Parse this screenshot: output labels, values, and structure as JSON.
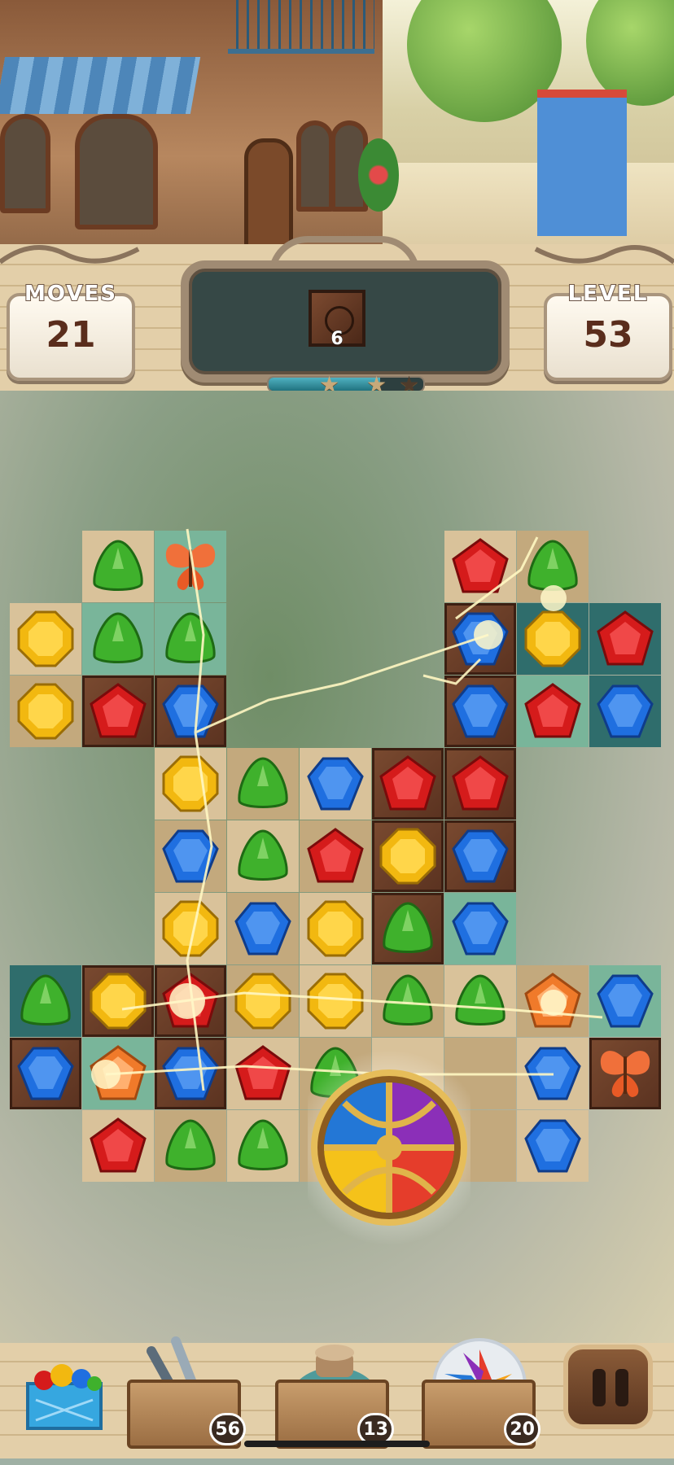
{
  "hud": {
    "moves_label": "MOVES",
    "moves_value": "21",
    "level_label": "LEVEL",
    "level_value": "53",
    "goal_count": "6",
    "goal_icon": "wood-crate-tile",
    "progress_fraction": 0.72,
    "stars_total": 3,
    "stars_earned": 2
  },
  "board": {
    "gem_colors": {
      "green": "#3fb12c",
      "yellow": "#f2b810",
      "blue": "#1f6fe0",
      "red": "#d51b1b",
      "orange": "#f07a2a"
    },
    "cells": [
      {
        "r": 0,
        "c": 1,
        "bg": "light",
        "gem": "green"
      },
      {
        "r": 0,
        "c": 2,
        "bg": "tealLight",
        "gem": "butterfly"
      },
      {
        "r": 0,
        "c": 6,
        "bg": "light",
        "gem": "red"
      },
      {
        "r": 0,
        "c": 7,
        "bg": "dark",
        "gem": "green"
      },
      {
        "r": 1,
        "c": 0,
        "bg": "light",
        "gem": "yellow"
      },
      {
        "r": 1,
        "c": 1,
        "bg": "tealLight",
        "gem": "green"
      },
      {
        "r": 1,
        "c": 2,
        "bg": "tealLight",
        "gem": "green"
      },
      {
        "r": 1,
        "c": 6,
        "bg": "wood",
        "gem": "blue"
      },
      {
        "r": 1,
        "c": 7,
        "bg": "teal",
        "gem": "yellow"
      },
      {
        "r": 1,
        "c": 8,
        "bg": "teal",
        "gem": "red"
      },
      {
        "r": 2,
        "c": 0,
        "bg": "dark",
        "gem": "yellow"
      },
      {
        "r": 2,
        "c": 1,
        "bg": "wood",
        "gem": "red"
      },
      {
        "r": 2,
        "c": 2,
        "bg": "wood",
        "gem": "blue"
      },
      {
        "r": 2,
        "c": 6,
        "bg": "wood",
        "gem": "blue"
      },
      {
        "r": 2,
        "c": 7,
        "bg": "tealLight",
        "gem": "red"
      },
      {
        "r": 2,
        "c": 8,
        "bg": "teal",
        "gem": "blue"
      },
      {
        "r": 3,
        "c": 2,
        "bg": "light",
        "gem": "yellow"
      },
      {
        "r": 3,
        "c": 3,
        "bg": "dark",
        "gem": "green"
      },
      {
        "r": 3,
        "c": 4,
        "bg": "light",
        "gem": "blue"
      },
      {
        "r": 3,
        "c": 5,
        "bg": "wood",
        "gem": "red"
      },
      {
        "r": 3,
        "c": 6,
        "bg": "wood",
        "gem": "red"
      },
      {
        "r": 4,
        "c": 2,
        "bg": "dark",
        "gem": "blue"
      },
      {
        "r": 4,
        "c": 3,
        "bg": "light",
        "gem": "green"
      },
      {
        "r": 4,
        "c": 4,
        "bg": "dark",
        "gem": "red"
      },
      {
        "r": 4,
        "c": 5,
        "bg": "wood",
        "gem": "yellow"
      },
      {
        "r": 4,
        "c": 6,
        "bg": "wood",
        "gem": "blue"
      },
      {
        "r": 5,
        "c": 2,
        "bg": "light",
        "gem": "yellow"
      },
      {
        "r": 5,
        "c": 3,
        "bg": "dark",
        "gem": "blue"
      },
      {
        "r": 5,
        "c": 4,
        "bg": "light",
        "gem": "yellow"
      },
      {
        "r": 5,
        "c": 5,
        "bg": "wood",
        "gem": "green"
      },
      {
        "r": 5,
        "c": 6,
        "bg": "tealLight",
        "gem": "blue"
      },
      {
        "r": 6,
        "c": 0,
        "bg": "teal",
        "gem": "green"
      },
      {
        "r": 6,
        "c": 1,
        "bg": "wood",
        "gem": "yellow"
      },
      {
        "r": 6,
        "c": 2,
        "bg": "wood",
        "gem": "red"
      },
      {
        "r": 6,
        "c": 3,
        "bg": "dark",
        "gem": "yellow"
      },
      {
        "r": 6,
        "c": 4,
        "bg": "light",
        "gem": "yellow"
      },
      {
        "r": 6,
        "c": 5,
        "bg": "dark",
        "gem": "green"
      },
      {
        "r": 6,
        "c": 6,
        "bg": "light",
        "gem": "green"
      },
      {
        "r": 6,
        "c": 7,
        "bg": "dark",
        "gem": "orange"
      },
      {
        "r": 6,
        "c": 8,
        "bg": "tealLight",
        "gem": "blue"
      },
      {
        "r": 7,
        "c": 0,
        "bg": "wood",
        "gem": "blue"
      },
      {
        "r": 7,
        "c": 1,
        "bg": "tealLight",
        "gem": "orange"
      },
      {
        "r": 7,
        "c": 2,
        "bg": "wood",
        "gem": "blue"
      },
      {
        "r": 7,
        "c": 3,
        "bg": "light",
        "gem": "red"
      },
      {
        "r": 7,
        "c": 4,
        "bg": "dark",
        "gem": "green"
      },
      {
        "r": 7,
        "c": 5,
        "bg": "light",
        "gem": ""
      },
      {
        "r": 7,
        "c": 6,
        "bg": "dark",
        "gem": ""
      },
      {
        "r": 7,
        "c": 7,
        "bg": "light",
        "gem": "blue"
      },
      {
        "r": 7,
        "c": 8,
        "bg": "wood",
        "gem": "butterfly"
      },
      {
        "r": 8,
        "c": 1,
        "bg": "light",
        "gem": "red"
      },
      {
        "r": 8,
        "c": 2,
        "bg": "dark",
        "gem": "green"
      },
      {
        "r": 8,
        "c": 3,
        "bg": "light",
        "gem": "green"
      },
      {
        "r": 8,
        "c": 4,
        "bg": "dark",
        "gem": ""
      },
      {
        "r": 8,
        "c": 5,
        "bg": "light",
        "gem": ""
      },
      {
        "r": 8,
        "c": 6,
        "bg": "dark",
        "gem": ""
      },
      {
        "r": 8,
        "c": 7,
        "bg": "light",
        "gem": "blue"
      }
    ]
  },
  "boosters": [
    {
      "name": "gem-box-booster",
      "count": ""
    },
    {
      "name": "tongs-booster",
      "count": "56"
    },
    {
      "name": "bomb-jar-booster",
      "count": "13"
    },
    {
      "name": "rainbow-orb-booster",
      "count": "20"
    }
  ],
  "pause_icon": "pause-icon"
}
